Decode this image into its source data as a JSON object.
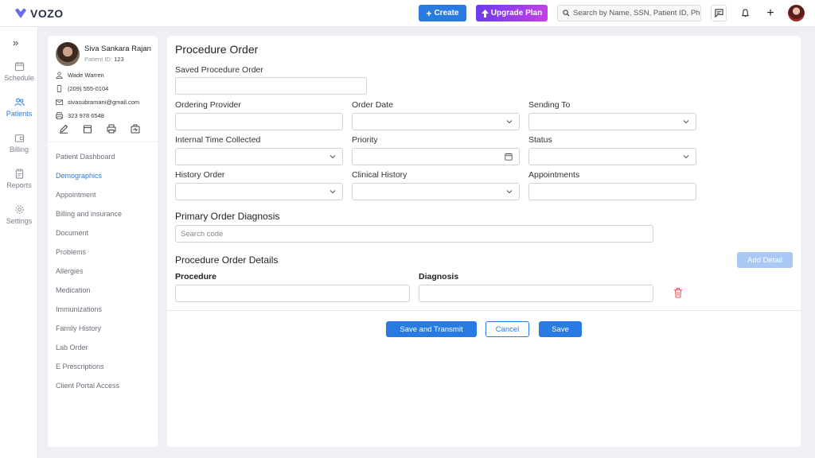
{
  "app": {
    "brand": "VOZO",
    "accent_color": "#2a7ae4"
  },
  "header": {
    "create_label": "Create",
    "upgrade_label": "Upgrade Plan",
    "search_placeholder": "Search by Name, SSN, Patient ID, Phone",
    "icons": [
      "logo-heart-icon",
      "plus-icon",
      "upload-arrow-icon",
      "search-icon",
      "message-icon",
      "bell-icon",
      "plus-icon",
      "user-avatar"
    ]
  },
  "leftnav": {
    "items": [
      {
        "label": "Schedule",
        "icon": "calendar-icon"
      },
      {
        "label": "Patients",
        "icon": "users-icon"
      },
      {
        "label": "Billing",
        "icon": "wallet-icon"
      },
      {
        "label": "Reports",
        "icon": "clipboard-icon"
      },
      {
        "label": "Settings",
        "icon": "gear-icon"
      }
    ],
    "active": "Patients"
  },
  "patient": {
    "name": "Siva Sankara Rajan",
    "id_label": "Patient ID:",
    "id_value": "123",
    "contact_name": "Wade Warren",
    "phone": "(209) 555-0104",
    "email": "sivasubramani@gmail.com",
    "fax": "323 978 6548",
    "menu": [
      "Patient Dashboard",
      "Demographics",
      "Appointment",
      "Billing and insurance",
      "Document",
      "Problems",
      "Allergies",
      "Medication",
      "Immunizations",
      "Family History",
      "Lab Order",
      "E Prescriptions",
      "Client Portal Access"
    ],
    "active_menu": "Demographics"
  },
  "form": {
    "title": "Procedure Order",
    "saved_label": "Saved Procedure Order",
    "ordering_provider_label": "Ordering Provider",
    "order_date_label": "Order Date",
    "sending_to_label": "Sending To",
    "internal_time_label": "Internal Time Collected",
    "priority_label": "Priority",
    "status_label": "Status",
    "history_order_label": "History Order",
    "clinical_history_label": "Clinical History",
    "appointments_label": "Appointments",
    "primary_dx_heading": "Primary Order Diagnosis",
    "search_code_placeholder": "Search code",
    "details_heading": "Procedure Order Details",
    "add_detail_label": "Add Detail",
    "procedure_label": "Procedure",
    "diagnosis_label": "Diagnosis"
  },
  "footer": {
    "save_transmit_label": "Save and Transmit",
    "cancel_label": "Cancel",
    "save_label": "Save"
  }
}
